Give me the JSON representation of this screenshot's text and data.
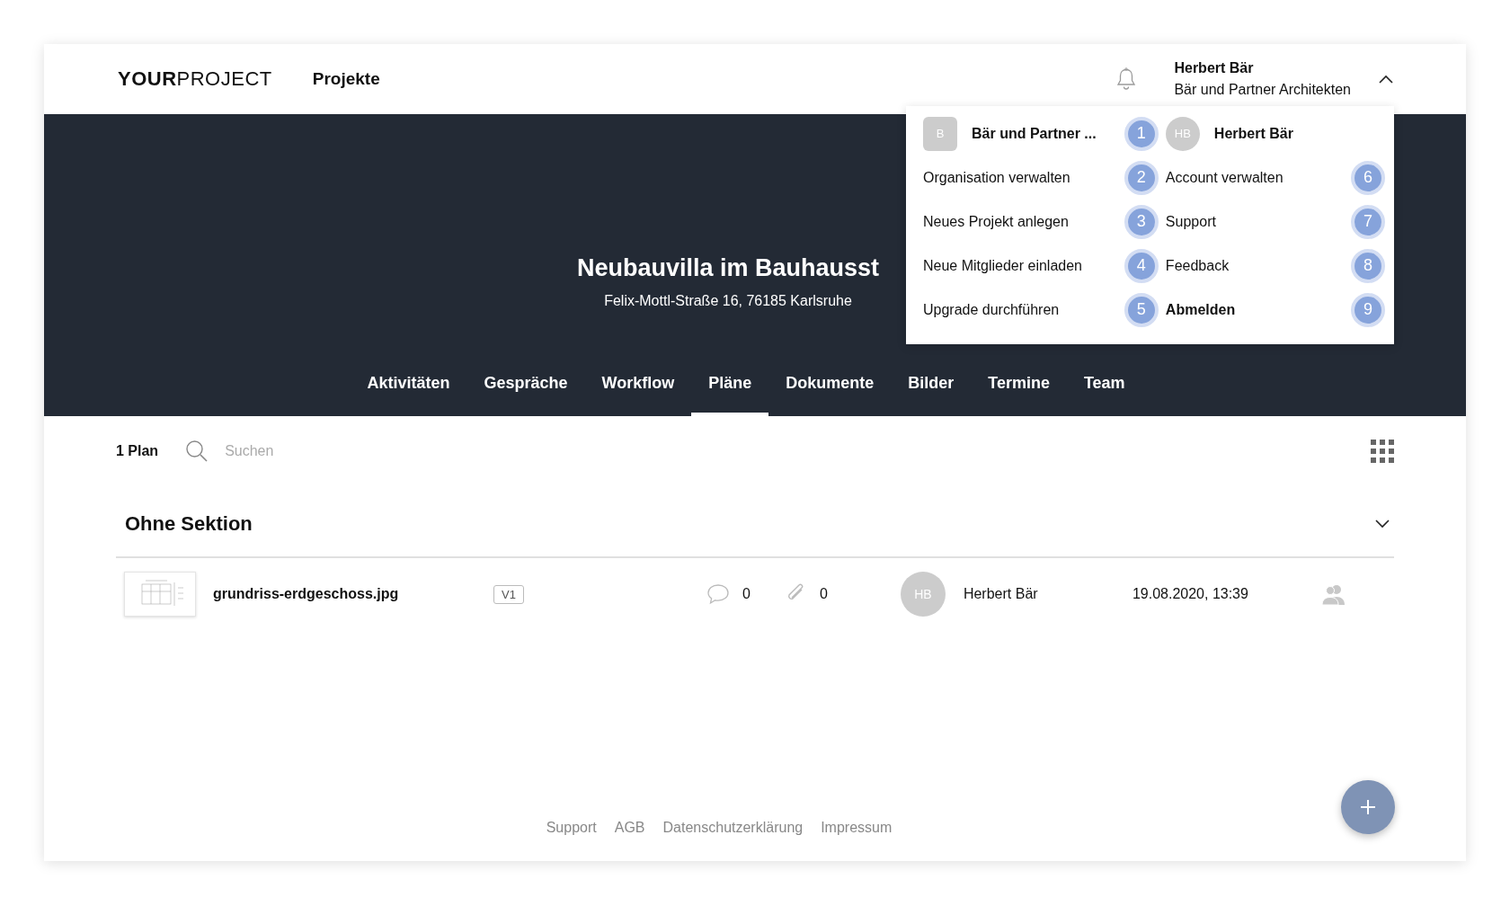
{
  "header": {
    "logo": "**YOUR**PROJECT",
    "nav_link": "Projekte",
    "user": {
      "name": "Herbert Bär",
      "organization": "Bär und Partner Architekten",
      "expanded": true
    }
  },
  "user_menu": {
    "columns": [
      {
        "items": [
          {
            "kind": "org",
            "avatar": "B",
            "label": "Bär und Partner ...",
            "shortcut": "1"
          },
          {
            "kind": "action",
            "label": "Organisation verwalten",
            "shortcut": "2"
          },
          {
            "kind": "action",
            "label": "Neues Projekt anlegen",
            "shortcut": "3"
          },
          {
            "kind": "action",
            "label": "Neue Mitglieder einladen",
            "shortcut": "4"
          },
          {
            "kind": "action",
            "label": "Upgrade durchführen",
            "shortcut": "5"
          }
        ]
      },
      {
        "items": [
          {
            "kind": "profile",
            "avatar": "HB",
            "label": "Herbert Bär"
          },
          {
            "kind": "action",
            "label": "Account verwalten",
            "shortcut": "6"
          },
          {
            "kind": "action",
            "label": "Support",
            "shortcut": "7"
          },
          {
            "kind": "action",
            "label": "Feedback",
            "shortcut": "8"
          },
          {
            "kind": "logout",
            "label": "Abmelden",
            "shortcut": "9"
          }
        ]
      }
    ]
  },
  "project": {
    "title": "Neubauvilla im Bauhausst",
    "address": "Felix-Mottl-Straße 16, 76185 Karlsruhe"
  },
  "tabs": [
    {
      "label": "Aktivitäten",
      "selected": false
    },
    {
      "label": "Gespräche",
      "selected": false
    },
    {
      "label": "Workflow",
      "selected": false
    },
    {
      "label": "Pläne",
      "selected": true
    },
    {
      "label": "Dokumente",
      "selected": false
    },
    {
      "label": "Bilder",
      "selected": false
    },
    {
      "label": "Termine",
      "selected": false
    },
    {
      "label": "Team",
      "selected": false
    }
  ],
  "toolbar": {
    "count": "1 Plan",
    "search": {
      "placeholder": "Suchen"
    }
  },
  "section": {
    "title": "Ohne Sektion",
    "expanded": true,
    "plans": [
      {
        "name": "grundriss-erdgeschoss.jpg",
        "version": "V1",
        "comments": "0",
        "attachments": "0",
        "author_initials": "HB",
        "author": "Herbert Bär",
        "date": "19.08.2020, 13:39"
      }
    ]
  },
  "footer": [
    "Support",
    "AGB",
    "Datenschutzerklärung",
    "Impressum"
  ]
}
